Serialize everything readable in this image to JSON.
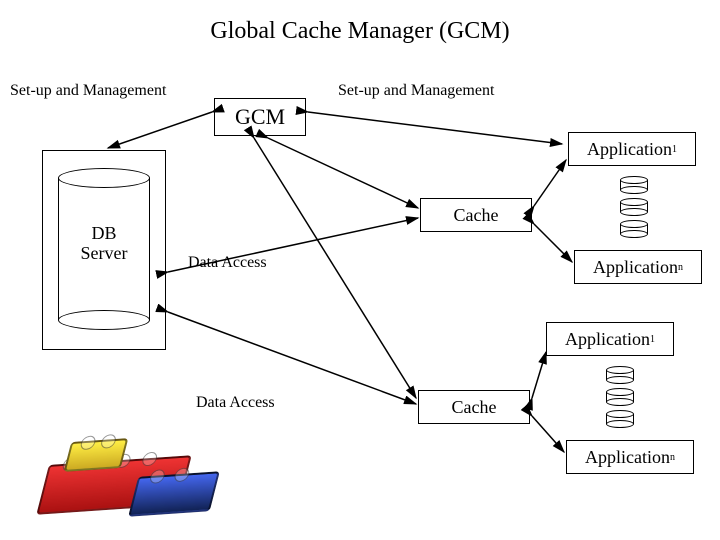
{
  "title": "Global Cache Manager (GCM)",
  "labels": {
    "setup_left": "Set-up and Management",
    "setup_right": "Set-up and Management",
    "data_access_1": "Data Access",
    "data_access_2": "Data Access"
  },
  "boxes": {
    "gcm": "GCM",
    "db_server_line1": "DB",
    "db_server_line2": "Server",
    "cache_1": "Cache",
    "cache_2": "Cache",
    "app1_a": "Application",
    "app1_a_sup": "1",
    "appn_a": "Application",
    "appn_a_sup": "n",
    "app1_b": "Application",
    "app1_b_sup": "1",
    "appn_b": "Application",
    "appn_b_sup": "n"
  }
}
